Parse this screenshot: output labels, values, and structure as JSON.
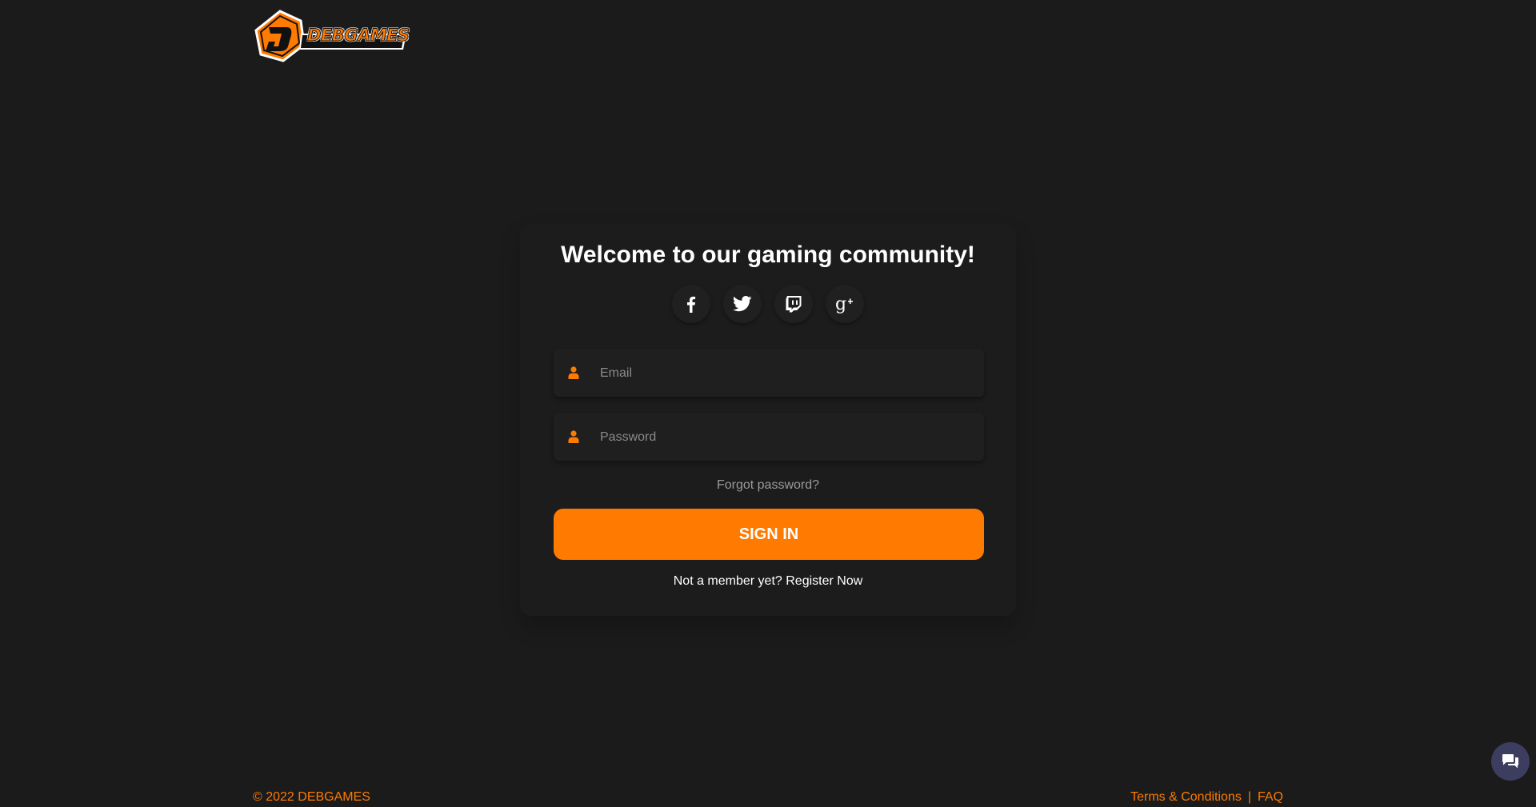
{
  "brand": {
    "name": "DEBGAMES",
    "logo_alt": "DEBGAMES logo",
    "accent_color": "#ff7a00",
    "background_color": "#1b1b1c"
  },
  "login": {
    "heading": "Welcome to our gaming community!",
    "social_buttons": [
      {
        "name": "facebook",
        "icon": "facebook-icon"
      },
      {
        "name": "twitter",
        "icon": "twitter-icon"
      },
      {
        "name": "twitch",
        "icon": "twitch-icon"
      },
      {
        "name": "google-plus",
        "icon": "google-plus-icon"
      }
    ],
    "email": {
      "placeholder": "Email",
      "value": "",
      "icon": "user-icon"
    },
    "password": {
      "placeholder": "Password",
      "value": "",
      "icon": "user-icon"
    },
    "forgot_password": "Forgot password?",
    "sign_in": "SIGN IN",
    "register_prompt": "Not a member yet? Register Now"
  },
  "footer": {
    "copyright": "© 2022 DEBGAMES",
    "links": [
      "Terms & Conditions",
      "FAQ"
    ],
    "separator": "|"
  },
  "chat_widget": {
    "icon": "chat-bubble-icon"
  }
}
